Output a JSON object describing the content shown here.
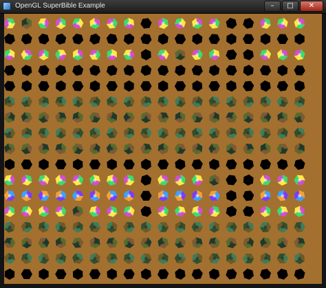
{
  "window": {
    "title": "OpenGL SuperBible Example",
    "controls": {
      "minimize": "–",
      "maximize": "□",
      "close": "✕"
    },
    "icon": "app-window-icon"
  },
  "scene": {
    "background_color": "#a3702f",
    "columns": 18,
    "rows": 17,
    "col_style": [
      "c",
      "c",
      "c",
      "c",
      "c",
      "c",
      "c",
      "c",
      "d",
      "c",
      "c",
      "c",
      "c",
      "d",
      "d",
      "c",
      "c",
      "c"
    ],
    "row_style": [
      "c",
      "d",
      "c",
      "d",
      "d",
      "t",
      "t",
      "t",
      "t",
      "d",
      "c",
      "c",
      "c",
      "t",
      "t",
      "t",
      "d"
    ],
    "palettes": {
      "c": [
        "#ffe94a",
        "#f0a23a",
        "#d24fd0",
        "#3ea0ff",
        "#3cdc6a",
        "#7a3cff"
      ],
      "t": [
        "#556b2f",
        "#2f4f2f",
        "#7b5a36",
        "#3d7d5b",
        "#1d3a2d",
        "#6a5a2a"
      ],
      "d": [
        "#000000",
        "#0b0b0b",
        "#050505"
      ]
    },
    "colors": {
      "cube_bright": "#f7d64b",
      "cube_magenta": "#d54dd7",
      "cube_cyan": "#40c8ff",
      "cube_green": "#3fd46a",
      "cube_dark": "#000000",
      "cube_shadow": "#5a3a18"
    }
  }
}
